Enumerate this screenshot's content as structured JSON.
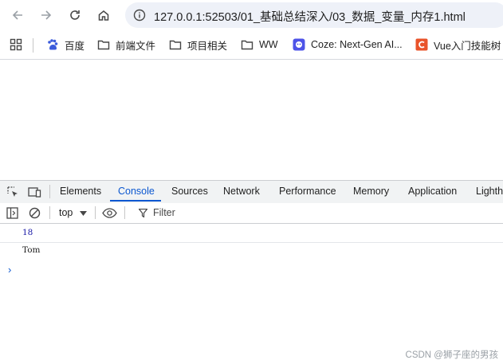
{
  "browser": {
    "url": "127.0.0.1:52503/01_基础总结深入/03_数据_变量_内存1.html",
    "icons": [
      "back-icon",
      "forward-icon",
      "reload-icon",
      "home-icon",
      "site-info-icon"
    ]
  },
  "bookmarks": {
    "items": [
      {
        "label": "百度",
        "icon": "baidu-icon"
      },
      {
        "label": "前端文件",
        "icon": "folder-icon"
      },
      {
        "label": "项目相关",
        "icon": "folder-icon"
      },
      {
        "label": "WW",
        "icon": "folder-icon"
      },
      {
        "label": "Coze: Next-Gen AI...",
        "icon": "coze-icon"
      },
      {
        "label": "Vue入门技能树",
        "icon": "csdn-icon"
      }
    ]
  },
  "devtools": {
    "tabs": [
      "Elements",
      "Console",
      "Sources",
      "Network",
      "Performance",
      "Memory",
      "Application",
      "Lighth"
    ],
    "active_tab": "Console",
    "context": "top",
    "filter_placeholder": "Filter",
    "accent_color": "#0b57d0"
  },
  "console": {
    "logs": [
      {
        "text": "18",
        "color": "#1a1aa6"
      },
      {
        "text": "Tom",
        "color": "#1f1f1f"
      }
    ],
    "prompt": "›"
  },
  "watermark": "CSDN @狮子座的男孩"
}
